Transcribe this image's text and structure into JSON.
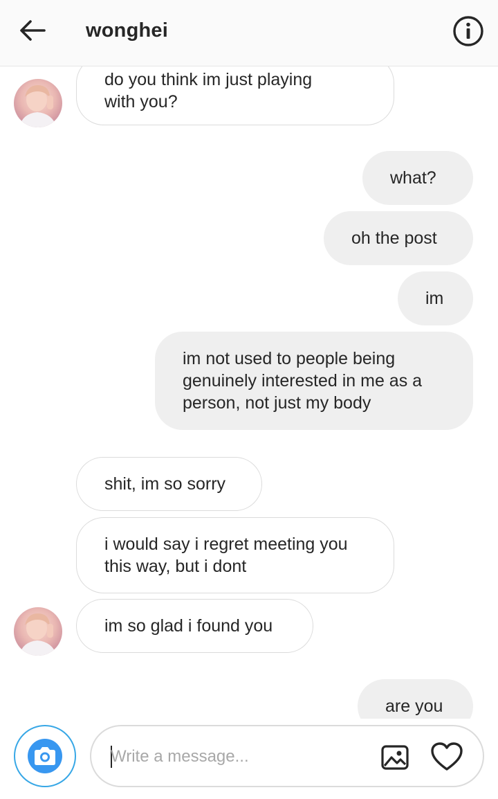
{
  "header": {
    "title": "wonghei",
    "icons": {
      "back": "arrow-left-icon",
      "info": "info-circle-icon"
    }
  },
  "messages": [
    {
      "dir": "in",
      "lines": [
        "do you think im just playing",
        "with you?"
      ]
    },
    {
      "dir": "out",
      "lines": [
        "what?"
      ]
    },
    {
      "dir": "out",
      "lines": [
        "oh the post"
      ]
    },
    {
      "dir": "out",
      "lines": [
        "im"
      ]
    },
    {
      "dir": "out",
      "lines": [
        "im not used to people being",
        "genuinely interested in me as a",
        "person, not just my body"
      ]
    },
    {
      "dir": "in",
      "lines": [
        "shit, im so sorry"
      ]
    },
    {
      "dir": "in",
      "lines": [
        "i would say i regret meeting you",
        "this way, but i dont"
      ]
    },
    {
      "dir": "in",
      "lines": [
        "im so glad i found you"
      ]
    },
    {
      "dir": "out",
      "lines": [
        "are you"
      ]
    }
  ],
  "composer": {
    "placeholder": "Write a message...",
    "icons": {
      "camera": "camera-icon",
      "gallery": "image-icon",
      "like": "heart-icon"
    }
  },
  "colors": {
    "incoming_bubble": "#ffffff",
    "incoming_border": "#dbdbdb",
    "outgoing_bubble": "#efefef",
    "camera_accent": "#3897f0",
    "text": "#262626"
  }
}
